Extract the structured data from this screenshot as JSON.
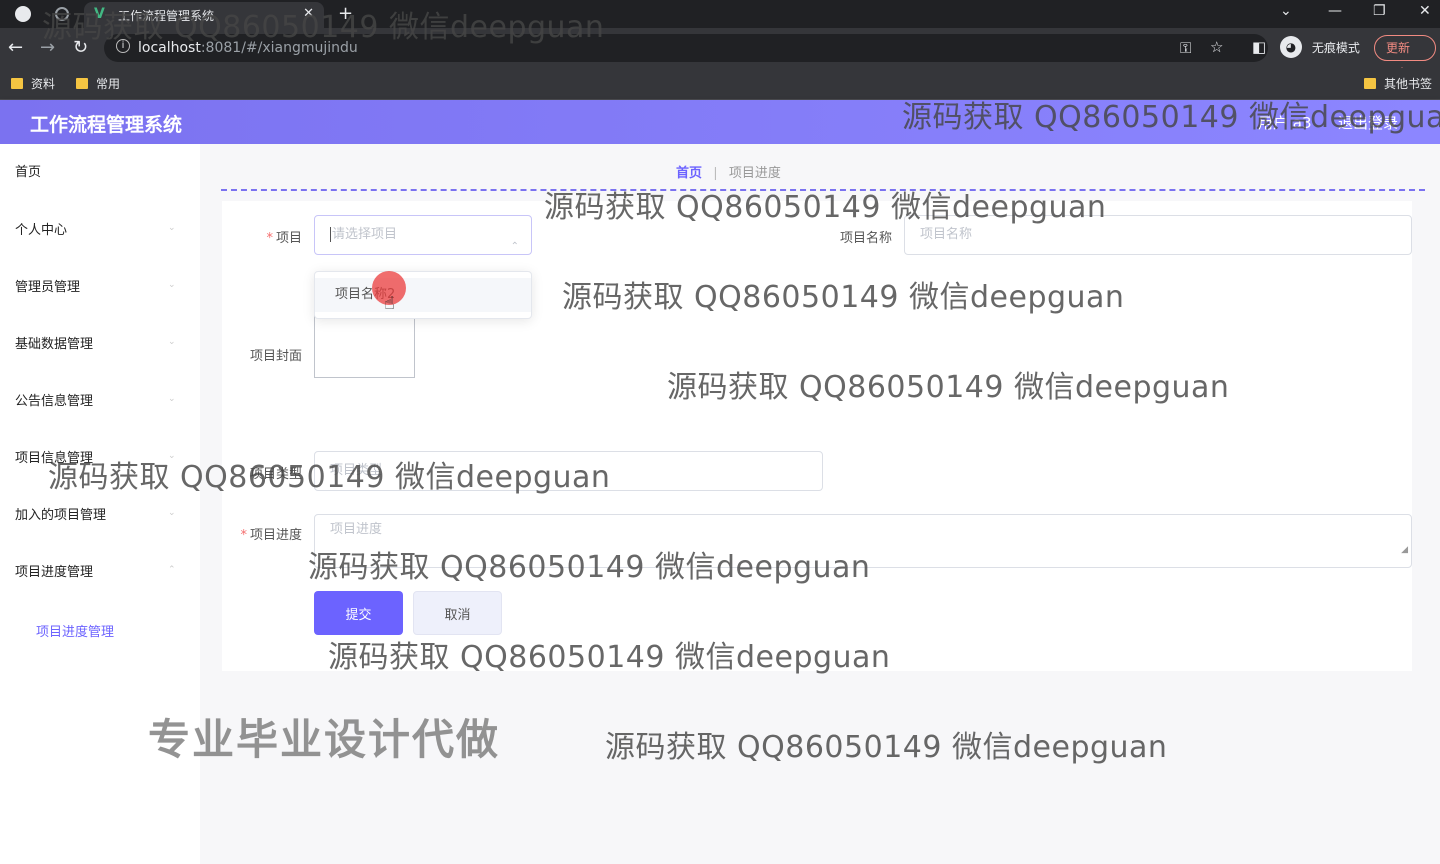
{
  "browser": {
    "tab_title": "工作流程管理系统",
    "tab_close": "✕",
    "new_tab": "+",
    "url_host": "localhost",
    "url_path": ":8081/#/xiangmujindu",
    "incognito_label": "无痕模式",
    "update_label": "更新",
    "bookmarks": [
      "资料",
      "常用"
    ],
    "other_bookmarks": "其他书签"
  },
  "app": {
    "title": "工作流程管理系统",
    "user": "用户 a3",
    "logout": "退出登录"
  },
  "sidebar": {
    "items": [
      "首页",
      "个人中心",
      "管理员管理",
      "基础数据管理",
      "公告信息管理",
      "项目信息管理",
      "加入的项目管理",
      "项目进度管理"
    ],
    "subitem": "项目进度管理"
  },
  "breadcrumb": {
    "home": "首页",
    "current": "项目进度"
  },
  "form": {
    "project_label": "项目",
    "project_placeholder": "请选择项目",
    "project_option": "项目名称2",
    "project_name_label": "项目名称",
    "project_name_placeholder": "项目名称",
    "cover_label": "项目封面",
    "type_label": "项目类型",
    "type_placeholder": "项目类型",
    "progress_label": "项目进度",
    "progress_placeholder": "项目进度",
    "submit": "提交",
    "cancel": "取消"
  },
  "watermarks": {
    "text": "源码获取 QQ86050149 微信deepguan",
    "banner": "专业毕业设计代做"
  }
}
